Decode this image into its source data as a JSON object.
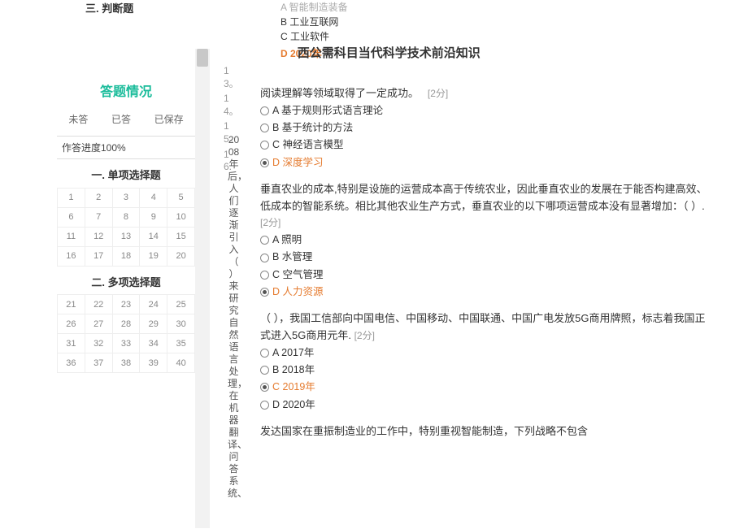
{
  "left": {
    "judge_section": "三. 判断题",
    "panel_title": "答题情况",
    "status": {
      "unanswered": "未答",
      "answered": "已答",
      "saved": "已保存"
    },
    "progress": "作答进度100%",
    "section1_title": "一. 单项选择题",
    "section2_title": "二. 多项选择题",
    "grid1": [
      "1",
      "2",
      "3",
      "4",
      "5",
      "6",
      "7",
      "8",
      "9",
      "10",
      "11",
      "12",
      "13",
      "14",
      "15",
      "16",
      "17",
      "18",
      "19",
      "20"
    ],
    "grid2": [
      "21",
      "22",
      "23",
      "24",
      "25",
      "26",
      "27",
      "28",
      "29",
      "30",
      "31",
      "32",
      "33",
      "34",
      "35",
      "36",
      "37",
      "38",
      "39",
      "40"
    ]
  },
  "side_numbers": [
    "13。",
    "14。",
    "15。",
    "16."
  ],
  "vertical_long": "2008年后，人们逐渐引入（ ）来研究自然语言处理，在机器翻译、问答系统、",
  "top_options": {
    "a_tail": "A 智能制造装备",
    "b": "B 工业互联网",
    "c": "C 工业软件",
    "d": "D 2020年"
  },
  "doc_title": "西公需科目当代科学技术前沿知识",
  "q13": {
    "stem": "阅读理解等领域取得了一定成功。",
    "score": "[2分]",
    "a": "A 基于规则形式语言理论",
    "b": "B 基于统计的方法",
    "c": "C 神经语言模型",
    "d": "D 深度学习"
  },
  "q14": {
    "stem": "垂直农业的成本,特别是设施的运营成本高于传统农业，因此垂直农业的发展在于能否构建高效、低成本的智能系统。相比其他农业生产方式，垂直农业的以下哪项运营成本没有显著增加：（ ）.",
    "score": "[2分]",
    "a": "A 照明",
    "b": "B 水管理",
    "c": "C 空气管理",
    "d": "D 人力资源"
  },
  "q15": {
    "stem": "（  ），我国工信部向中国电信、中国移动、中国联通、中国广电发放5G商用牌照，标志着我国正式进入5G商用元年.",
    "score": "[2分]",
    "a": "A 2017年",
    "b": "B 2018年",
    "c": "C 2019年",
    "d": "D 2020年"
  },
  "q16": {
    "stem": "发达国家在重振制造业的工作中，特别重视智能制造，下列战略不包含"
  }
}
